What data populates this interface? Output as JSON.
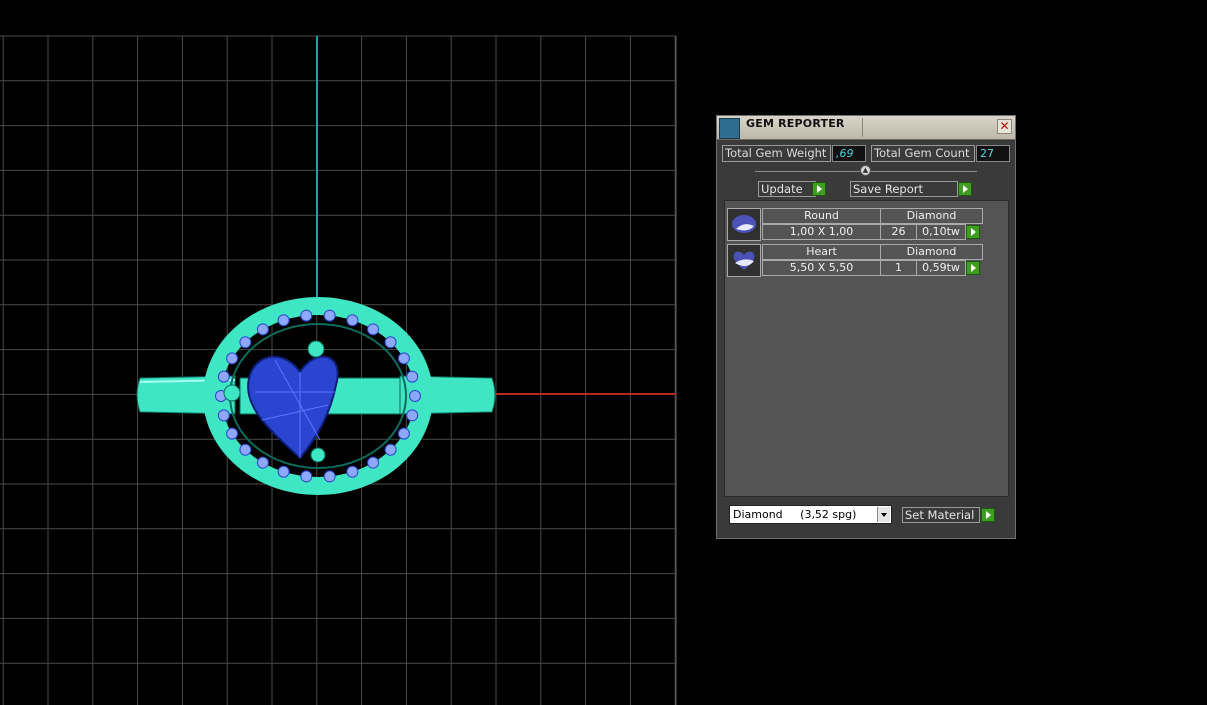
{
  "panel": {
    "title": "GEM REPORTER",
    "close_icon": "close-icon",
    "total_gem_weight_label": "Total Gem Weight",
    "total_gem_weight_value": ",69",
    "total_gem_count_label": "Total Gem Count",
    "total_gem_count_value": "27",
    "update_label": "Update",
    "save_report_label": "Save Report",
    "gems": [
      {
        "shape": "Round",
        "material": "Diamond",
        "size": "1,00 X 1,00",
        "count": "26",
        "weight": "0,10tw"
      },
      {
        "shape": "Heart",
        "material": "Diamond",
        "size": "5,50 X 5,50",
        "count": "1",
        "weight": "0,59tw"
      }
    ],
    "material_select_value": "Diamond     (3,52 spg)",
    "set_material_label": "Set Material"
  },
  "colors": {
    "grid": "#4a4a4a",
    "axis_vertical": "#1fa3a8",
    "axis_horizontal": "#b52a18",
    "ring_metal": "#3ee6c4",
    "gem_blue": "#2a45d0",
    "accent_green": "#3f9e22"
  }
}
